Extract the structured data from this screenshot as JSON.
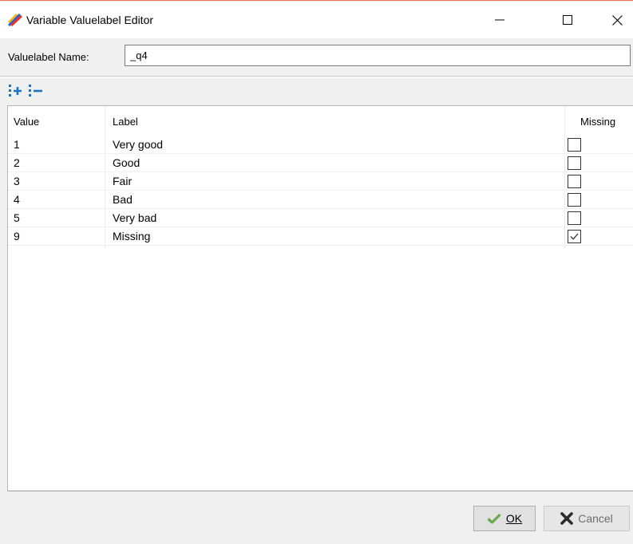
{
  "window": {
    "title": "Variable Valuelabel Editor",
    "icon": "app-logo-icon",
    "controls": [
      "minimize-icon",
      "maximize-icon",
      "close-icon"
    ]
  },
  "name_row": {
    "label": "Valuelabel Name:",
    "value": "_q4"
  },
  "toolbar": {
    "buttons": [
      "add-row-icon",
      "remove-row-icon"
    ]
  },
  "table": {
    "headers": {
      "value": "Value",
      "label": "Label",
      "missing": "Missing"
    },
    "rows": [
      {
        "value": "1",
        "label": "Very good",
        "missing": false
      },
      {
        "value": "2",
        "label": "Good",
        "missing": false
      },
      {
        "value": "3",
        "label": "Fair",
        "missing": false
      },
      {
        "value": "4",
        "label": "Bad",
        "missing": false
      },
      {
        "value": "5",
        "label": "Very bad",
        "missing": false
      },
      {
        "value": "9",
        "label": "Missing",
        "missing": true
      }
    ]
  },
  "footer": {
    "ok_label": "OK",
    "cancel_label": "Cancel"
  },
  "colors": {
    "accent": "#1e73be",
    "ok_check": "#6aa84f"
  }
}
